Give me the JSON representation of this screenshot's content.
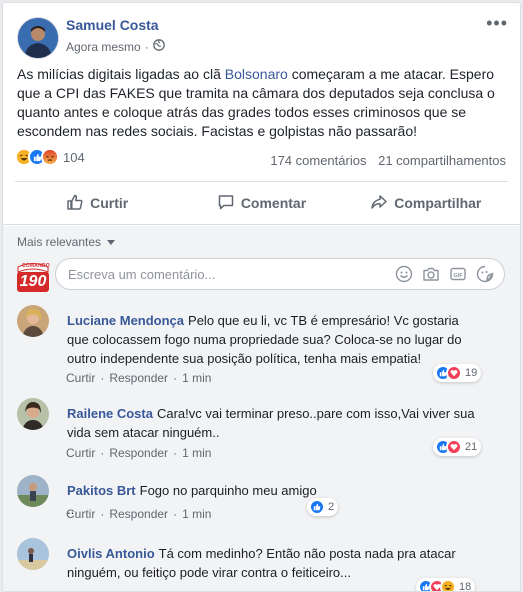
{
  "post": {
    "author": "Samuel Costa",
    "time": "Agora mesmo",
    "more": "•••",
    "text_before": "As milícias digitais ligadas ao clã ",
    "mention": "Bolsonaro",
    "text_after": " começaram a me atacar. Espero que a CPI das FAKES que tramita na câmara dos deputados seja conclusa o quanto antes e coloque atrás das grades todos esses criminosos que se escondem nas redes sociais. Facistas e golpistas não passarão!",
    "reaction_count": "104",
    "comments_count": "174 comentários",
    "shares_count": "21 compartilhamentos"
  },
  "actions": {
    "like": "Curtir",
    "comment": "Comentar",
    "share": "Compartilhar"
  },
  "comments_header": "Mais relevantes",
  "composer": {
    "badge_top": "COMANDO",
    "badge_number": "190",
    "placeholder": "Escreva um comentário..."
  },
  "comment_actions": {
    "like": "Curtir",
    "reply": "Responder"
  },
  "comments": [
    {
      "name": "Luciane Mendonça",
      "text": "Pelo que eu li, vc TB é empresário! Vc gostaria que colocassem fogo numa propriedade sua? Coloca-se no lugar do outro independente sua posição política, tenha mais empatia!",
      "time": "1 min",
      "reactions": "19"
    },
    {
      "name": "Railene Costa",
      "text": "Cara!vc vai terminar preso..pare com isso,Vai viver sua vida sem atacar ninguém..",
      "time": "1 min",
      "reactions": "21"
    },
    {
      "name": "Pakitos Brt",
      "text": "Fogo no parquinho meu amigo ...",
      "time": "1 min",
      "reactions": "2"
    },
    {
      "name": "Oivlis Antonio",
      "text": "Tá com medinho? Então não posta nada pra atacar ninguém, ou feitiço pode virar contra o feiticeiro...",
      "time": "",
      "reactions": "18"
    }
  ],
  "colors": {
    "link": "#385898",
    "like_blue": "#1877f2",
    "love_red": "#f33e58",
    "haha_yellow": "#f7b125",
    "angry_orange": "#e9710f"
  }
}
